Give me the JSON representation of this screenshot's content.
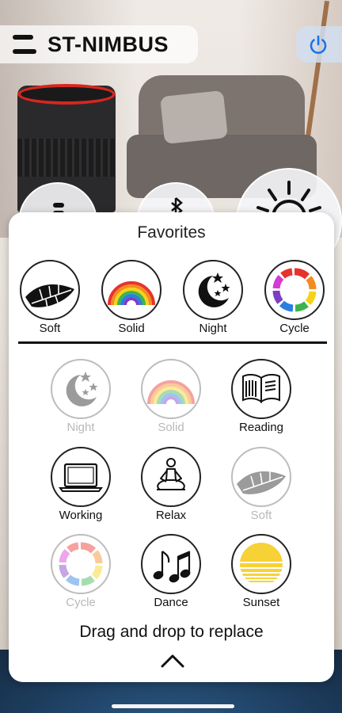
{
  "header": {
    "title": "ST-NIMBUS",
    "menu_icon": "hamburger-icon",
    "power_icon": "power-icon"
  },
  "favorites": {
    "title": "Favorites",
    "items": [
      {
        "label": "Soft",
        "icon": "feather-icon"
      },
      {
        "label": "Solid",
        "icon": "rainbow-icon"
      },
      {
        "label": "Night",
        "icon": "moon-stars-icon"
      },
      {
        "label": "Cycle",
        "icon": "color-ring-icon"
      }
    ]
  },
  "modes": {
    "items": [
      {
        "label": "Night",
        "icon": "moon-stars-icon",
        "disabled": true
      },
      {
        "label": "Solid",
        "icon": "rainbow-icon",
        "disabled": true
      },
      {
        "label": "Reading",
        "icon": "book-icon",
        "disabled": false
      },
      {
        "label": "Working",
        "icon": "laptop-icon",
        "disabled": false
      },
      {
        "label": "Relax",
        "icon": "meditation-icon",
        "disabled": false
      },
      {
        "label": "Soft",
        "icon": "feather-icon",
        "disabled": true
      },
      {
        "label": "Cycle",
        "icon": "color-ring-icon",
        "disabled": true
      },
      {
        "label": "Dance",
        "icon": "music-notes-icon",
        "disabled": false
      },
      {
        "label": "Sunset",
        "icon": "sunset-icon",
        "disabled": false
      }
    ]
  },
  "footer": {
    "instruction": "Drag and drop to replace",
    "collapse_icon": "chevron-up-icon"
  },
  "colors": {
    "accent_blue": "#1a73e8",
    "sunset_yellow": "#f7d237",
    "panel": "#ffffff"
  }
}
